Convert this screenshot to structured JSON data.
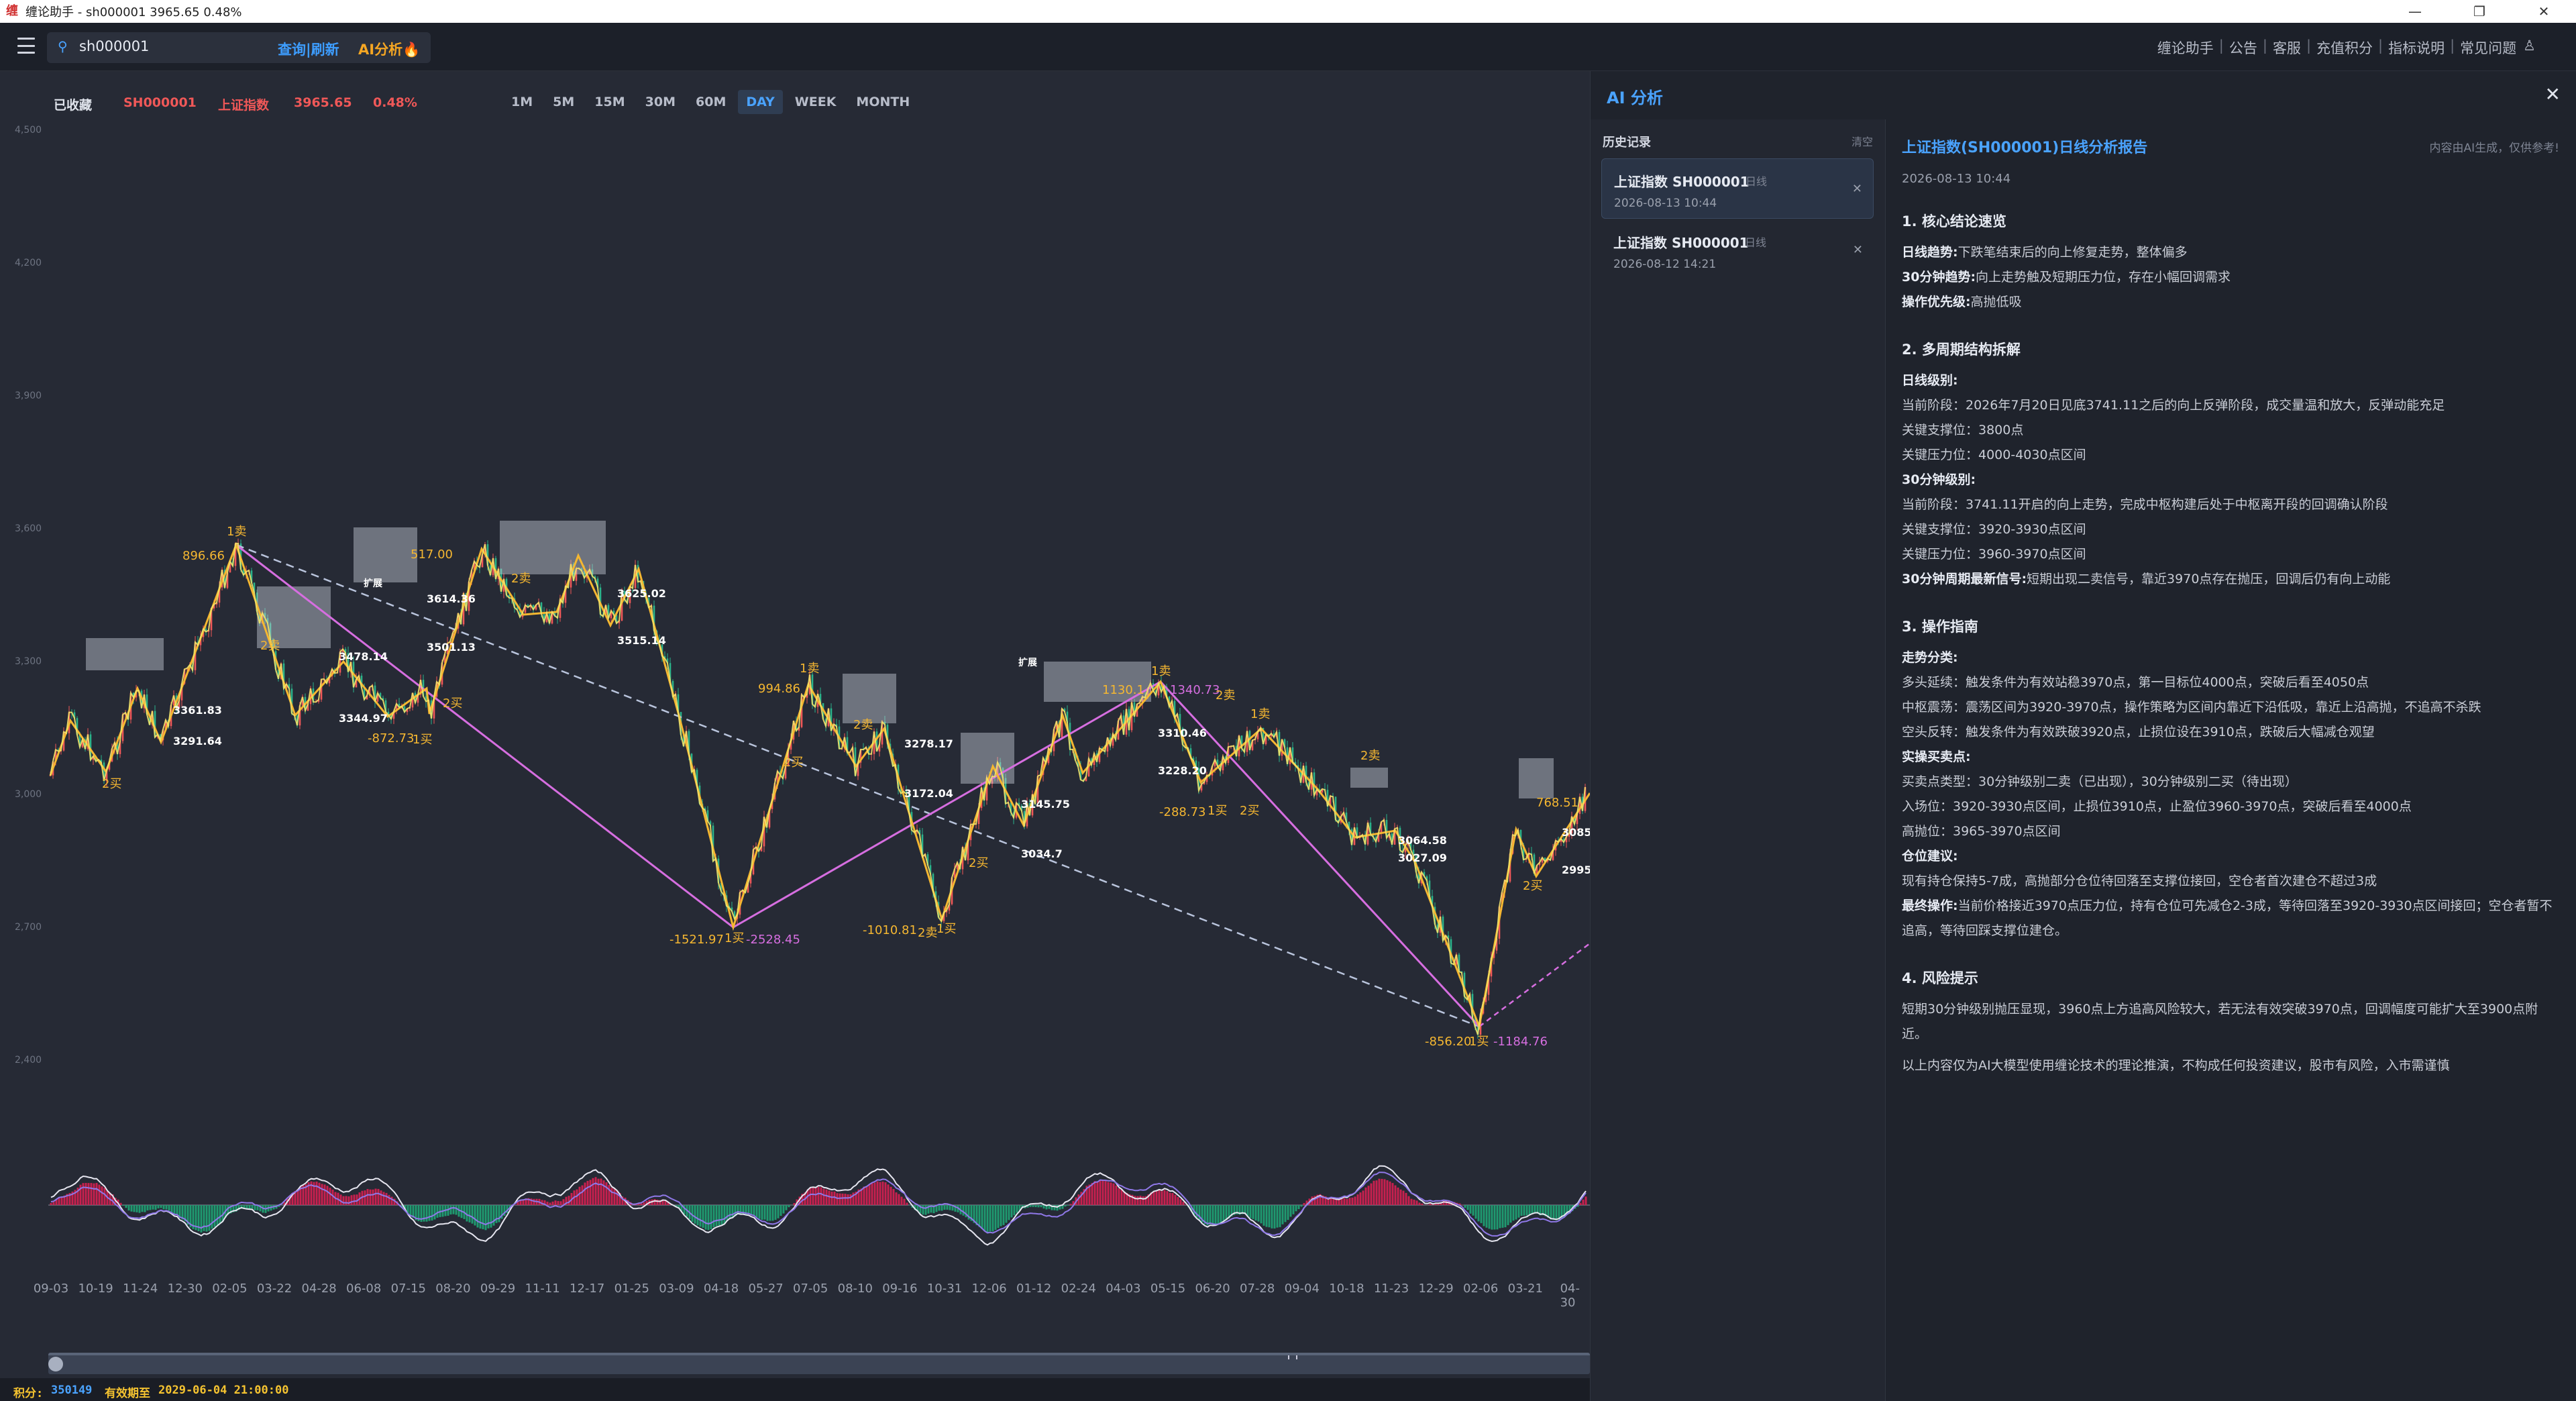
{
  "window": {
    "title": "缠论助手 - sh000001 3965.65 0.48%",
    "controls": [
      "—",
      "❐",
      "✕"
    ]
  },
  "toolbar": {
    "search_value": "sh000001",
    "query_label": "查询|刷新",
    "ai_label": "AI分析🔥",
    "links": [
      "缠论助手",
      "公告",
      "客服",
      "充值积分",
      "指标说明",
      "常见问题"
    ]
  },
  "quote": {
    "fav": "已收藏",
    "code": "SH000001",
    "name": "上证指数",
    "price": "3965.65",
    "pct": "0.48%"
  },
  "periods": [
    "1M",
    "5M",
    "15M",
    "30M",
    "60M",
    "DAY",
    "WEEK",
    "MONTH"
  ],
  "active_period": "DAY",
  "chart_data": {
    "type": "line",
    "ytick_labels": [
      "4,500",
      "4,200",
      "3,900",
      "3,600",
      "3,300",
      "3,000",
      "2,700",
      "2,400"
    ],
    "xtick_labels": [
      "09-03",
      "10-19",
      "11-24",
      "12-30",
      "02-05",
      "03-22",
      "04-28",
      "06-08",
      "07-15",
      "08-20",
      "09-29",
      "11-11",
      "12-17",
      "01-25",
      "03-09",
      "04-18",
      "05-27",
      "07-05",
      "08-10",
      "09-16",
      "10-31",
      "12-06",
      "01-12",
      "02-24",
      "04-03",
      "05-15",
      "06-20",
      "07-28",
      "09-04",
      "10-18",
      "11-23",
      "12-29",
      "02-06",
      "03-21",
      "04-30"
    ],
    "annotations": {
      "price_labels": [
        "3361.83",
        "3291.64",
        "3478.14",
        "3344.97",
        "3614.36",
        "3501.13",
        "3625.02",
        "3515.14",
        "3278.17",
        "3172.04",
        "3145.75",
        "3034.7",
        "3310.46",
        "3228.20",
        "3064.58",
        "3027.09",
        "3085.",
        "2995."
      ],
      "move_labels": [
        "896.66",
        "-872.73",
        "517.00",
        "-1521.97",
        "-2528.45",
        "994.86",
        "-1010.81",
        "1130.1",
        "1340.73",
        "-288.73",
        "-856.20",
        "-1184.76",
        "768.51"
      ],
      "signals": [
        "1卖",
        "2卖",
        "1买",
        "2买",
        "扩展"
      ]
    }
  },
  "status": {
    "points_label": "积分:",
    "points_value": "350149",
    "expiry_label": "有效期至",
    "expiry_value": "2029-06-04 21:00:00"
  },
  "ai_panel": {
    "title": "AI 分析",
    "close": "✕",
    "history_title": "历史记录",
    "history_clear": "清空",
    "history": [
      {
        "name": "上证指数 SH000001",
        "tag": "日线",
        "time": "2026-08-13 10:44"
      },
      {
        "name": "上证指数 SH000001",
        "tag": "日线",
        "time": "2026-08-12 14:21"
      }
    ],
    "report": {
      "title": "上证指数(SH000001)日线分析报告",
      "note": "内容由AI生成，仅供参考!",
      "time": "2026-08-13 10:44",
      "s1": "1. 核心结论速览",
      "s1_l1_k": "日线趋势:",
      "s1_l1_v": "下跌笔结束后的向上修复走势，整体偏多",
      "s1_l2_k": "30分钟趋势:",
      "s1_l2_v": "向上走势触及短期压力位，存在小幅回调需求",
      "s1_l3_k": "操作优先级:",
      "s1_l3_v": "高抛低吸",
      "s2": "2. 多周期结构拆解",
      "s2_day": "日线级别:",
      "s2_d1": "当前阶段：2026年7月20日见底3741.11之后的向上反弹阶段，成交量温和放大，反弹动能充足",
      "s2_d2": "关键支撑位：3800点",
      "s2_d3": "关键压力位：4000-4030点区间",
      "s2_m30": "30分钟级别:",
      "s2_m1": "当前阶段：3741.11开启的向上走势，完成中枢构建后处于中枢离开段的回调确认阶段",
      "s2_m2": "关键支撑位：3920-3930点区间",
      "s2_m3": "关键压力位：3960-3970点区间",
      "s2_sig_k": "30分钟周期最新信号:",
      "s2_sig_v": "短期出现二卖信号，靠近3970点存在抛压，回调后仍有向上动能",
      "s3": "3. 操作指南",
      "s3_cat": "走势分类:",
      "s3_c1": "多头延续：触发条件为有效站稳3970点，第一目标位4000点，突破后看至4050点",
      "s3_c2": "中枢震荡：震荡区间为3920-3970点，操作策略为区间内靠近下沿低吸，靠近上沿高抛，不追高不杀跌",
      "s3_c3": "空头反转：触发条件为有效跌破3920点，止损位设在3910点，跌破后大幅减仓观望",
      "s3_bs": "实操买卖点:",
      "s3_b1": "买卖点类型：30分钟级别二卖（已出现），30分钟级别二买（待出现）",
      "s3_b2": "入场位：3920-3930点区间，止损位3910点，止盈位3960-3970点，突破后看至4000点",
      "s3_b3": "高抛位：3965-3970点区间",
      "s3_pos": "仓位建议:",
      "s3_p1": "现有持仓保持5-7成，高抛部分仓位待回落至支撑位接回，空仓者首次建仓不超过3成",
      "s3_final_k": "最终操作:",
      "s3_final_v": "当前价格接近3970点压力位，持有仓位可先减仓2-3成，等待回落至3920-3930点区间接回；空仓者暂不追高，等待回踩支撑位建仓。",
      "s4": "4. 风险提示",
      "s4_p1": "短期30分钟级别抛压显现，3960点上方追高风险较大，若无法有效突破3970点，回调幅度可能扩大至3900点附近。",
      "s4_p2": "以上内容仅为AI大模型使用缠论技术的理论推演，不构成任何投资建议，股市有风险，入市需谨慎"
    }
  },
  "colors": {
    "accent": "#4aa3ff",
    "up": "#f05858",
    "bi_line": "#f5b731",
    "segment_line": "#d66ee0",
    "trend_dash": "#b9c4dc",
    "macd_pos": "#c8204f",
    "macd_neg": "#1f9a70"
  }
}
